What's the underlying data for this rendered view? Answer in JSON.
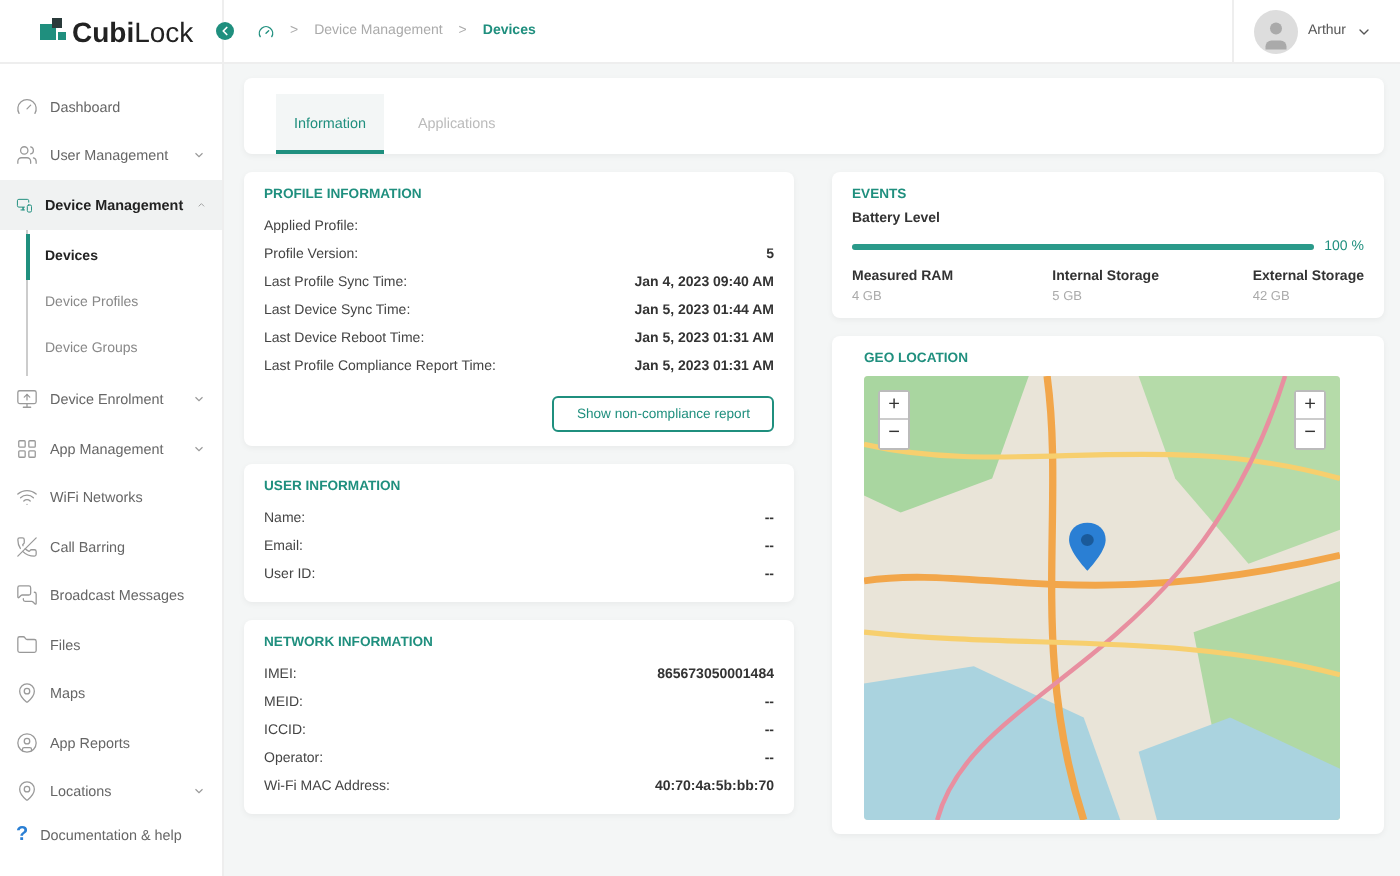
{
  "brand": {
    "name": "Cubi",
    "name_light": "Lock"
  },
  "breadcrumb": {
    "items": [
      {
        "label": "Device Management",
        "selected": false
      },
      {
        "label": "Devices",
        "selected": true
      }
    ],
    "separator": ">"
  },
  "user": {
    "name": "Arthur"
  },
  "sidebar": {
    "items": [
      {
        "kind": "link",
        "label": "Dashboard",
        "selected": false
      },
      {
        "kind": "group",
        "label": "User Management",
        "expanded": false,
        "selected": false
      },
      {
        "kind": "group",
        "label": "Device Management",
        "expanded": true,
        "selected": true,
        "children": [
          {
            "label": "Devices",
            "selected": true
          },
          {
            "label": "Device Profiles",
            "selected": false
          },
          {
            "label": "Device Groups",
            "selected": false
          }
        ]
      },
      {
        "kind": "group",
        "label": "Device Enrolment",
        "expanded": false,
        "selected": false
      },
      {
        "kind": "group",
        "label": "App Management",
        "expanded": false,
        "selected": false
      },
      {
        "kind": "link",
        "label": "WiFi Networks",
        "selected": false
      },
      {
        "kind": "link",
        "label": "Call Barring",
        "selected": false
      },
      {
        "kind": "link",
        "label": "Broadcast Messages",
        "selected": false
      },
      {
        "kind": "link",
        "label": "Files",
        "selected": false
      },
      {
        "kind": "link",
        "label": "Maps",
        "selected": false
      },
      {
        "kind": "link",
        "label": "App Reports",
        "selected": false
      },
      {
        "kind": "group",
        "label": "Locations",
        "expanded": false,
        "selected": false
      }
    ],
    "help": {
      "icon": "?",
      "label": "Documentation & help"
    }
  },
  "tabs": [
    {
      "label": "Information",
      "selected": true
    },
    {
      "label": "Applications",
      "selected": false
    }
  ],
  "profile_information": {
    "title": "PROFILE INFORMATION",
    "rows": [
      {
        "label": "Applied Profile:",
        "value": ""
      },
      {
        "label": "Profile Version:",
        "value": "5"
      },
      {
        "label": "Last Profile Sync Time:",
        "value": "Jan 4, 2023 09:40 AM"
      },
      {
        "label": "Last Device Sync Time:",
        "value": "Jan 5, 2023 01:44 AM"
      },
      {
        "label": "Last Device Reboot Time:",
        "value": "Jan 5, 2023 01:31 AM"
      },
      {
        "label": "Last Profile Compliance Report Time:",
        "value": "Jan 5, 2023 01:31 AM"
      }
    ],
    "button": "Show non-compliance report"
  },
  "user_information": {
    "title": "USER INFORMATION",
    "rows": [
      {
        "label": "Name:",
        "value": "--"
      },
      {
        "label": "Email:",
        "value": "--"
      },
      {
        "label": "User ID:",
        "value": "--"
      }
    ]
  },
  "network_information": {
    "title": "NETWORK INFORMATION",
    "rows": [
      {
        "label": "IMEI:",
        "value": "865673050001484"
      },
      {
        "label": "MEID:",
        "value": "--"
      },
      {
        "label": "ICCID:",
        "value": "--"
      },
      {
        "label": "Operator:",
        "value": "--"
      },
      {
        "label": "Wi-Fi MAC Address:",
        "value": "40:70:4a:5b:bb:70"
      }
    ]
  },
  "events": {
    "title": "EVENTS",
    "battery": {
      "label": "Battery Level",
      "level": 1,
      "reading": "100 %"
    },
    "stats": [
      {
        "label": "Measured RAM",
        "value": "4 GB"
      },
      {
        "label": "Internal Storage",
        "value": "5 GB"
      },
      {
        "label": "External Storage",
        "value": "42 GB"
      }
    ]
  },
  "geo_location": {
    "title": "GEO LOCATION",
    "zoom_in": "+",
    "zoom_out": "−"
  }
}
